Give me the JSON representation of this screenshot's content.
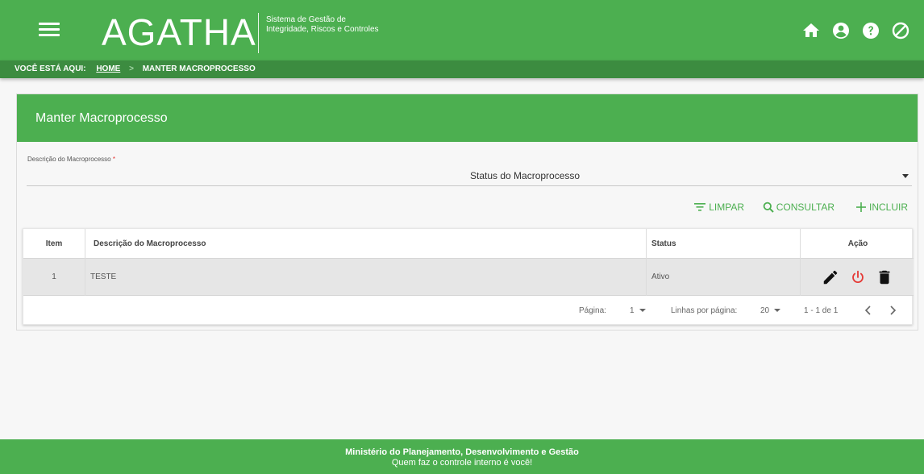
{
  "header": {
    "app_name": "AGATHA",
    "subtitle": "Sistema de Gestão de Integridade, Riscos e Controles",
    "icons": [
      "menu-icon",
      "home-icon",
      "user-icon",
      "help-icon",
      "block-icon"
    ]
  },
  "breadcrumb": {
    "prefix": "VOCÊ ESTÁ AQUI:",
    "home": "HOME",
    "separator": ">",
    "current": "MANTER MACROPROCESSO"
  },
  "panel": {
    "title": "Manter Macroprocesso"
  },
  "form": {
    "description_label": "Descrição do Macroprocesso",
    "required_mark": "*",
    "description_value": "",
    "status_label": "Status do Macroprocesso"
  },
  "actions": {
    "clear": "LIMPAR",
    "search": "CONSULTAR",
    "add": "INCLUIR"
  },
  "table": {
    "headers": {
      "item": "Item",
      "description": "Descrição do Macroprocesso",
      "status": "Status",
      "action": "Ação"
    },
    "rows": [
      {
        "item": "1",
        "description": "TESTE",
        "status": "Ativo"
      }
    ]
  },
  "pagination": {
    "page_label": "Página:",
    "page_value": "1",
    "rows_label": "Linhas por página:",
    "rows_value": "20",
    "range": "1 - 1 de 1"
  },
  "footer": {
    "line1": "Ministério do Planejamento, Desenvolvimento e Gestão",
    "line2": "Quem faz o controle interno é você!"
  },
  "colors": {
    "primary": "#4caf50",
    "breadcrumb": "#3c8c40",
    "danger": "#e53935"
  }
}
